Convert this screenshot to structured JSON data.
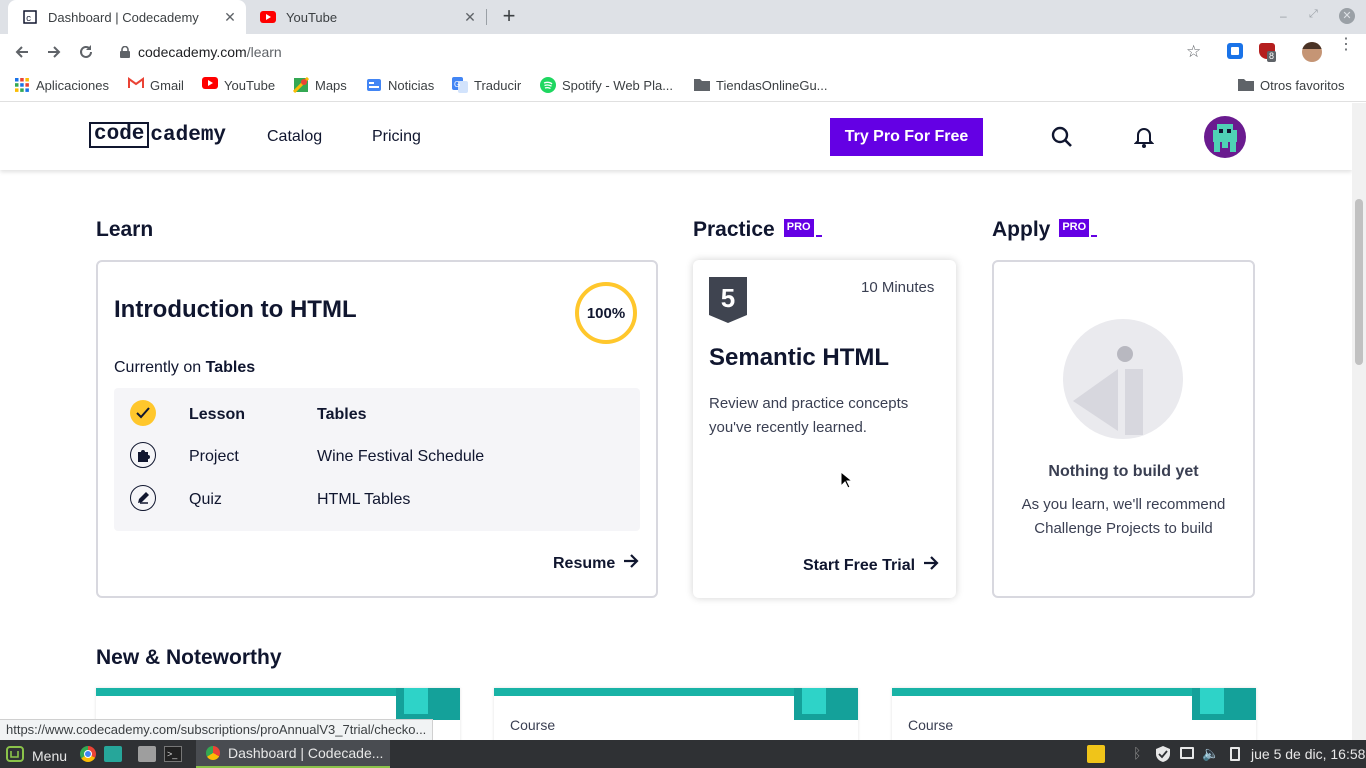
{
  "browser": {
    "tabs": [
      {
        "title": "Dashboard | Codecademy",
        "active": true
      },
      {
        "title": "YouTube",
        "active": false
      }
    ],
    "url_host": "codecademy.com",
    "url_path": "/learn",
    "extension_badge": "8",
    "bookmarks": [
      {
        "label": "Aplicaciones",
        "icon": "apps-grid-icon"
      },
      {
        "label": "Gmail",
        "icon": "gmail-icon"
      },
      {
        "label": "YouTube",
        "icon": "youtube-icon"
      },
      {
        "label": "Maps",
        "icon": "maps-icon"
      },
      {
        "label": "Noticias",
        "icon": "news-icon"
      },
      {
        "label": "Traducir",
        "icon": "translate-icon"
      },
      {
        "label": "Spotify - Web Pla...",
        "icon": "spotify-icon"
      },
      {
        "label": "TiendasOnlineGu...",
        "icon": "folder-icon"
      }
    ],
    "other_bookmarks": "Otros favoritos",
    "status_url": "https://www.codecademy.com/subscriptions/proAnnualV3_7trial/checko..."
  },
  "site": {
    "logo_box": "code",
    "logo_rest": "cademy",
    "nav": [
      "Catalog",
      "Pricing"
    ],
    "try_pro": "Try Pro For Free"
  },
  "learn": {
    "heading": "Learn",
    "course_title": "Introduction to HTML",
    "progress": "100%",
    "progress_value": 1.0,
    "currently_prefix": "Currently on",
    "currently_item": "Tables",
    "rows": [
      {
        "type": "Lesson",
        "name": "Tables",
        "icon": "check-icon",
        "done": true
      },
      {
        "type": "Project",
        "name": "Wine Festival Schedule",
        "icon": "puzzle-icon",
        "done": false
      },
      {
        "type": "Quiz",
        "name": "HTML Tables",
        "icon": "pencil-icon",
        "done": false
      }
    ],
    "resume": "Resume"
  },
  "practice": {
    "heading": "Practice",
    "badge": "PRO",
    "duration": "10 Minutes",
    "title": "Semantic HTML",
    "description": "Review and practice concepts you've recently learned.",
    "cta": "Start Free Trial"
  },
  "apply": {
    "heading": "Apply",
    "badge": "PRO",
    "empty_title": "Nothing to build yet",
    "empty_desc": "As you learn, we'll recommend Challenge Projects to build"
  },
  "noteworthy": {
    "heading": "New & Noteworthy",
    "cards": [
      {
        "label": ""
      },
      {
        "label": "Course"
      },
      {
        "label": "Course"
      }
    ]
  },
  "taskbar": {
    "menu": "Menu",
    "window": "Dashboard | Codecade...",
    "clock": "jue 5 de dic, 16:58"
  },
  "colors": {
    "brand_purple": "#6400e4",
    "ring_yellow": "#ffc72c",
    "teal": "#19b3a6",
    "navy": "#10162f"
  }
}
